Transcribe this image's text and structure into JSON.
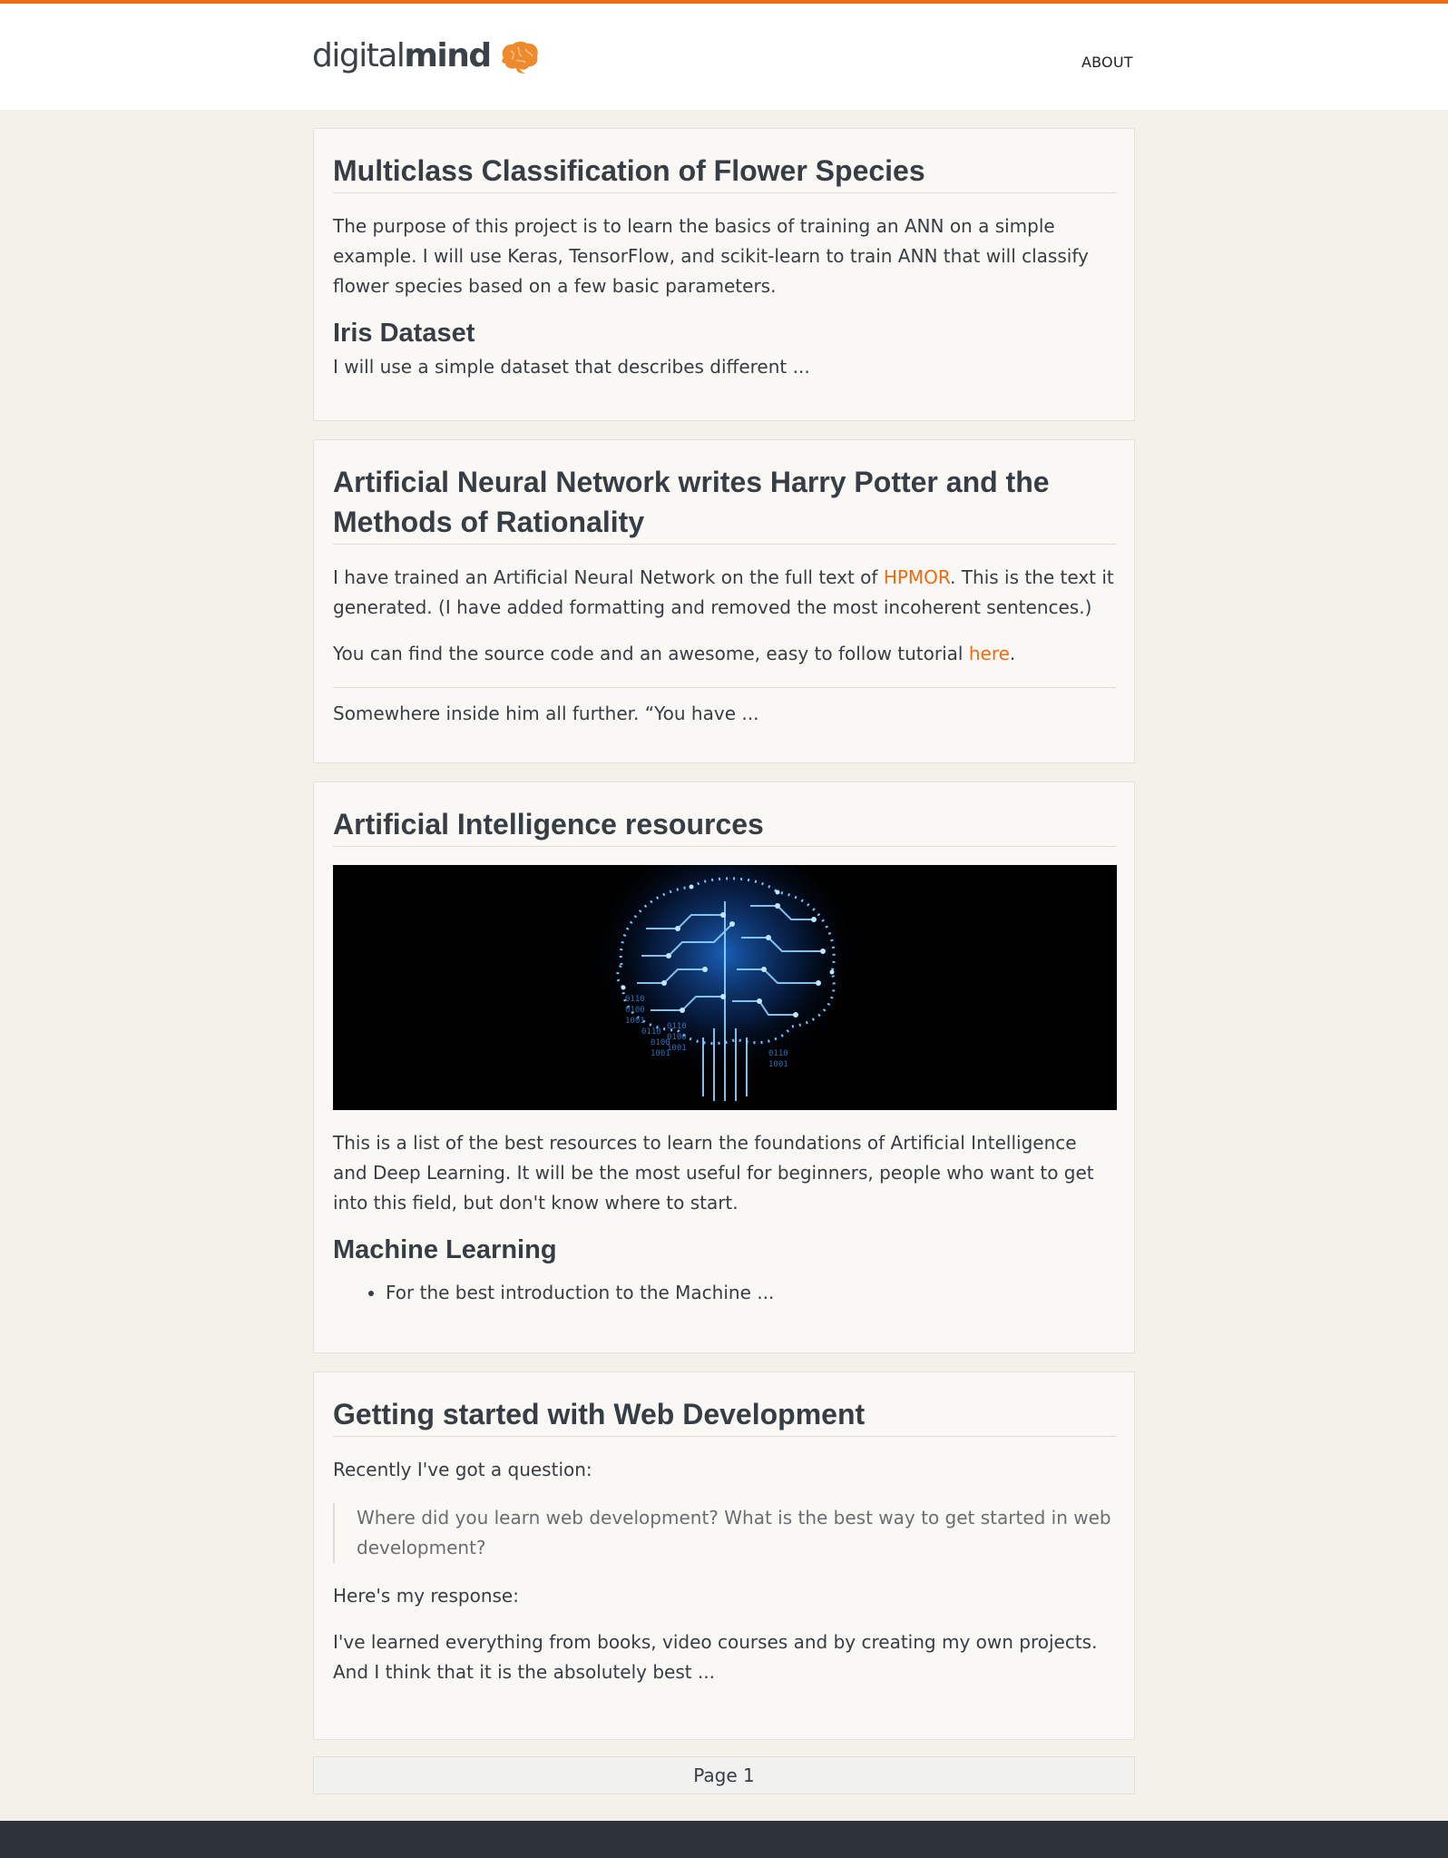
{
  "site": {
    "logo_part1": "digital",
    "logo_part2": "mind",
    "nav_about": "ABOUT",
    "accent_color": "#ee6a10",
    "logo_icon": "brain-icon"
  },
  "posts": [
    {
      "title": "Multiclass Classification of Flower Species",
      "paragraph1": "The purpose of this project is to learn the basics of training an ANN on a simple example. I will use Keras, TensorFlow, and scikit-learn to train ANN that will classify flower species based on a few basic parameters.",
      "subheading": "Iris Dataset",
      "excerpt": "I will use a simple dataset that describes different ..."
    },
    {
      "title": "Artificial Neural Network writes Harry Potter and the Methods of Rationality",
      "p1_before": "I have trained an Artificial Neural Network on the full text of ",
      "p1_link": "HPMOR",
      "p1_after": ". This is the text it generated. (I have added formatting and removed the most incoherent sentences.)",
      "p2_before": "You can find the source code and an awesome, easy to follow tutorial ",
      "p2_link": "here",
      "p2_after": ".",
      "excerpt": "Somewhere inside him all further. “You have ..."
    },
    {
      "title": "Artificial Intelligence resources",
      "image_alt": "circuit-brain-image",
      "paragraph1": "This is a list of the best resources to learn the foundations of Artificial Intelligence and Deep Learning. It will be the most useful for beginners, people who want to get into this field, but don't know where to start.",
      "subheading": "Machine Learning",
      "list_item": "For the best introduction to the Machine ..."
    },
    {
      "title": "Getting started with Web Development",
      "intro": "Recently I've got a question:",
      "quote": "Where did you learn web development? What is the best way to get started in web development?",
      "response_label": "Here's my response:",
      "excerpt": "I've learned everything from books, video courses and by creating my own projects. And I think that it is the absolutely best ..."
    }
  ],
  "pager": {
    "label": "Page 1"
  }
}
